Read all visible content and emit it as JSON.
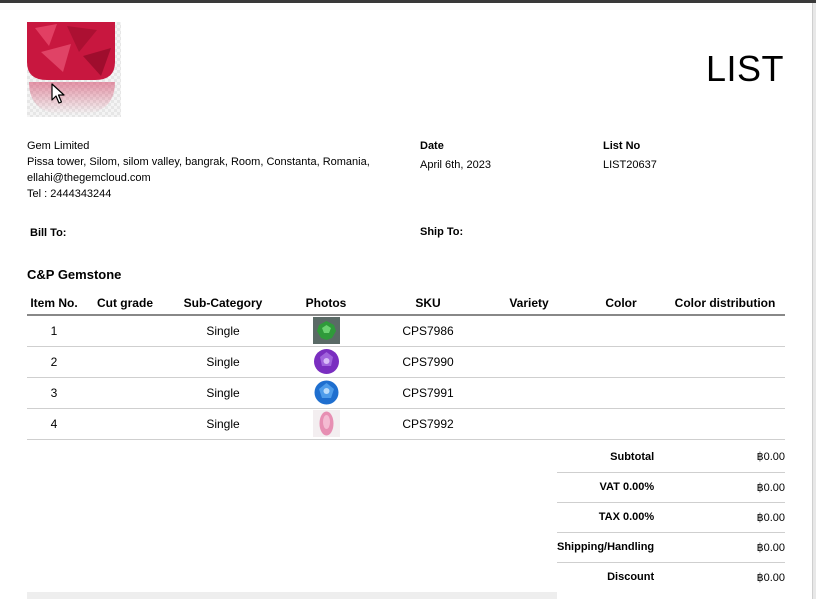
{
  "document": {
    "title": "LIST"
  },
  "company": {
    "name": "Gem Limited",
    "address": "Pissa tower, Silom, silom valley, bangrak, Room, Constanta, Romania,",
    "email": "ellahi@thegemcloud.com",
    "phone": "Tel : 2444343244"
  },
  "meta": {
    "date_label": "Date",
    "date_value": "April 6th, 2023",
    "list_no_label": "List No",
    "list_no_value": "LIST20637",
    "bill_to_label": "Bill To:",
    "ship_to_label": "Ship To:"
  },
  "section": {
    "title": "C&P Gemstone"
  },
  "table": {
    "columns": [
      "Item No.",
      "Cut grade",
      "Sub-Category",
      "Photos",
      "SKU",
      "Variety",
      "Color",
      "Color distribution"
    ],
    "rows": [
      {
        "item_no": "1",
        "cut_grade": "",
        "sub_category": "Single",
        "photo": "green-gem-icon",
        "sku": "CPS7986",
        "variety": "",
        "color": "",
        "color_distribution": ""
      },
      {
        "item_no": "2",
        "cut_grade": "",
        "sub_category": "Single",
        "photo": "purple-gem-icon",
        "sku": "CPS7990",
        "variety": "",
        "color": "",
        "color_distribution": ""
      },
      {
        "item_no": "3",
        "cut_grade": "",
        "sub_category": "Single",
        "photo": "blue-gem-icon",
        "sku": "CPS7991",
        "variety": "",
        "color": "",
        "color_distribution": ""
      },
      {
        "item_no": "4",
        "cut_grade": "",
        "sub_category": "Single",
        "photo": "pink-gem-icon",
        "sku": "CPS7992",
        "variety": "",
        "color": "",
        "color_distribution": ""
      }
    ]
  },
  "totals": [
    {
      "label": "Subtotal",
      "value": "฿0.00"
    },
    {
      "label": "VAT 0.00%",
      "value": "฿0.00"
    },
    {
      "label": "TAX 0.00%",
      "value": "฿0.00"
    },
    {
      "label": "Shipping/Handling",
      "value": "฿0.00"
    },
    {
      "label": "Discount",
      "value": "฿0.00"
    }
  ],
  "colors": {
    "logo_gem": "#c8173f",
    "gem_green": "#2f9a3a",
    "gem_purple": "#7a2ec0",
    "gem_blue": "#1f6fcf",
    "gem_pink": "#e78fb3",
    "rule": "#888888"
  }
}
